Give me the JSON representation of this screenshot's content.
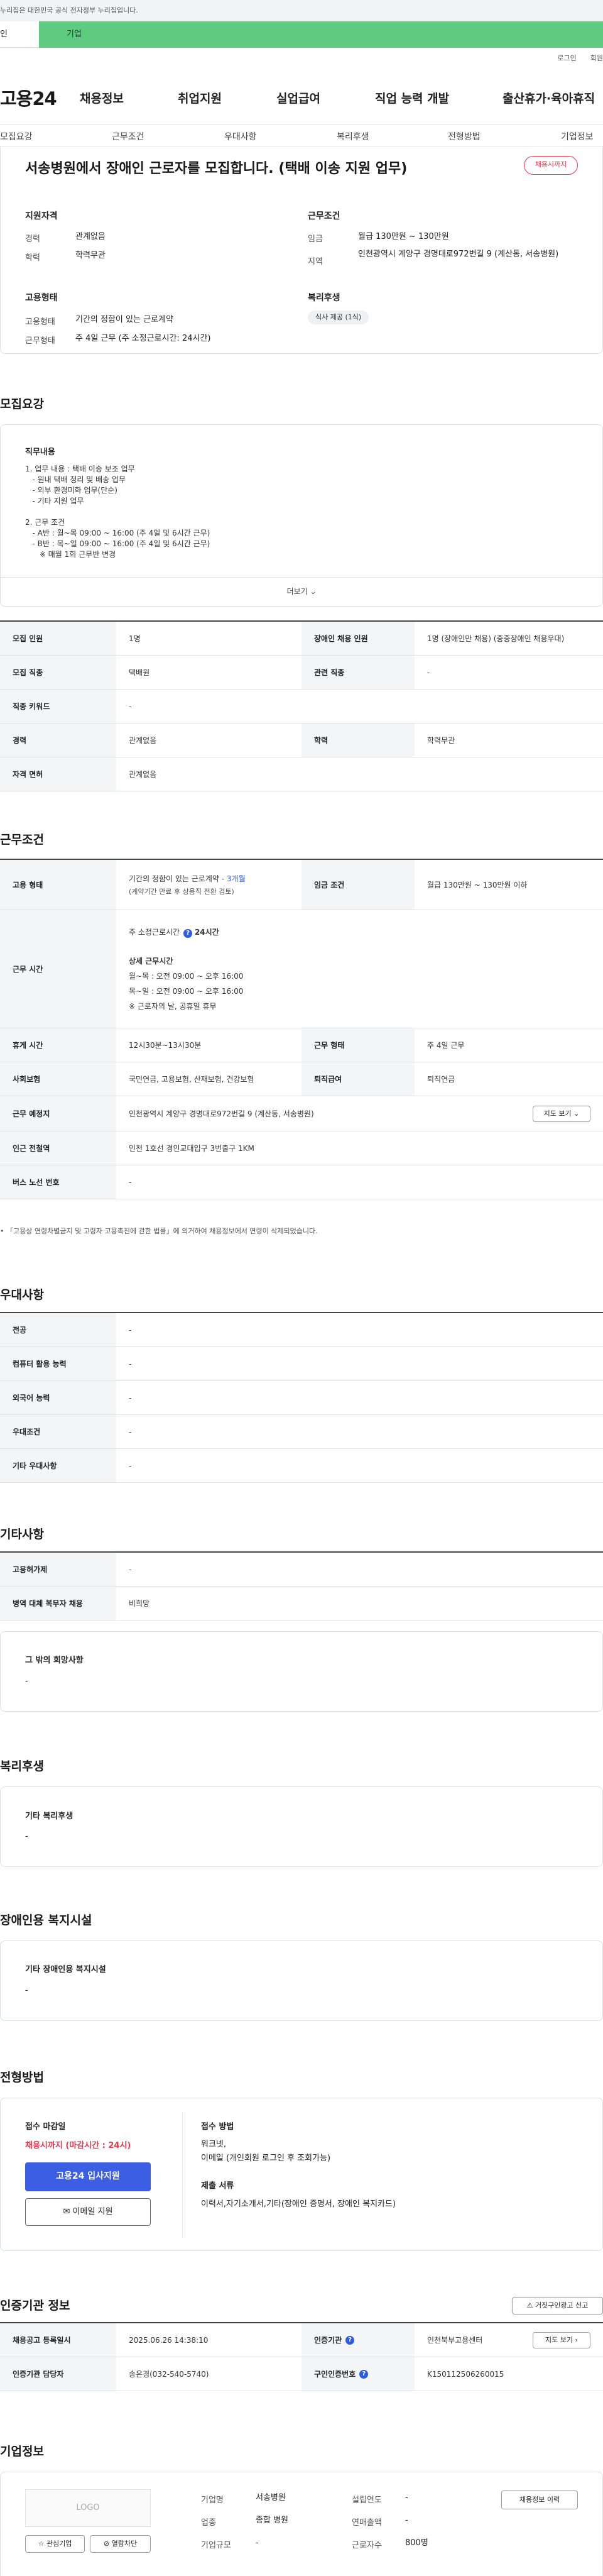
{
  "gov_banner": "누리집은 대한민국 공식 전자정부 누리집입니다.",
  "top_tabs": [
    "인",
    "기업"
  ],
  "util": [
    "로그인",
    "회원"
  ],
  "logo": "고용24",
  "gnb": [
    "채용정보",
    "취업지원",
    "실업급여",
    "직업 능력 개발",
    "출산휴가·육아휴직"
  ],
  "subnav": [
    "모집요강",
    "근무조건",
    "우대사항",
    "복리후생",
    "전형방법",
    "기업정보"
  ],
  "summary": {
    "title": "서송병원에서 장애인 근로자를 모집합니다. (택배 이송 지원 업무)",
    "badge": "채용시까지",
    "qual_heading": "지원자격",
    "career_label": "경력",
    "career_value": "관계없음",
    "edu_label": "학력",
    "edu_value": "학력무관",
    "work_heading": "근무조건",
    "wage_label": "임금",
    "wage_value": "월급 130만원 ~ 130만원",
    "region_label": "지역",
    "region_value": "인천광역시 계양구 경명대로972번길 9 (계산동, 서송병원)",
    "emp_heading": "고용형태",
    "emp_type_label": "고용형태",
    "emp_type_value": "기간의 정함이 있는 근로계약",
    "work_form_label": "근무형태",
    "work_form_value": "주 4일 근무 (주 소정근로시간: 24시간)",
    "welfare_heading": "복리후생",
    "welfare_chip": "식사 제공 (1식)"
  },
  "recruit": {
    "section_title": "모집요강",
    "duty_heading": "직무내용",
    "duty_text": "1. 업무 내용 : 택배 이송 보조 업무\n   - 원내 택배 정리 및 배송 업무\n   - 외부 환경미화 업무(단순)\n   - 기타 지원 업무\n\n2. 근무 조건\n   - A반 : 월~목 09:00 ~ 16:00 (주 4일 및 6시간 근무)\n   - B반 : 목~일 09:00 ~ 16:00 (주 4일 및 6시간 근무)\n      ※ 매월 1회 근무반 변경",
    "more": "더보기",
    "table": [
      {
        "h1": "모집 인원",
        "v1": "1명",
        "h2": "장애인 채용 인원",
        "v2": "1명 (장애인만 채용) (중증장애인 채용우대)"
      },
      {
        "h1": "모집 직종",
        "v1": "택배원",
        "h2": "관련 직종",
        "v2": "-"
      },
      {
        "h1": "직종 키워드",
        "v1": "-"
      },
      {
        "h1": "경력",
        "v1": "관계없음",
        "h2": "학력",
        "v2": "학력무관"
      },
      {
        "h1": "자격 면허",
        "v1": "관계없음"
      }
    ]
  },
  "conditions": {
    "section_title": "근무조건",
    "emp_type_label": "고용 형태",
    "emp_type_value": "기간의 정함이 있는 근로계약 - ",
    "emp_type_months": "3개월",
    "emp_type_note": "(계약기간 만료 후 상용직 전환 검토)",
    "wage_label": "임금 조건",
    "wage_value": "월급 130만원 ~ 130만원 이하",
    "hours_label": "근무 시간",
    "hours_weekly": "주 소정근로시간",
    "hours_weekly_value": "24시간",
    "hours_detail_heading": "상세 근무시간",
    "hours_lines": [
      "월~목 : 오전 09:00 ~ 오후 16:00",
      "목~일 : 오전 09:00 ~ 오후 16:00",
      "※ 근로자의 날, 공휴일 휴무"
    ],
    "rest_label": "휴게 시간",
    "rest_value": "12시30분~13시30분",
    "form_label": "근무 형태",
    "form_value": "주 4일 근무",
    "insurance_label": "사회보험",
    "insurance_value": "국민연금, 고용보험, 산재보험, 건강보험",
    "severance_label": "퇴직급여",
    "severance_value": "퇴직연금",
    "place_label": "근무 예정지",
    "place_value": "인천광역시 계양구 경명대로972번길 9 (계산동, 서송병원)",
    "map_button": "지도 보기",
    "station_label": "인근 전철역",
    "station_value": "인천 1호선 경인교대입구 3번출구 1KM",
    "bus_label": "버스 노선 번호",
    "bus_value": "-",
    "footnote": "「고용상 연령차별금지 및 고령자 고용촉진에 관한 법률」에 의거하여 채용정보에서 연령이 삭제되었습니다."
  },
  "preference": {
    "section_title": "우대사항",
    "rows": [
      {
        "label": "전공",
        "value": "-"
      },
      {
        "label": "컴퓨터 활용 능력",
        "value": "-"
      },
      {
        "label": "외국어 능력",
        "value": "-"
      },
      {
        "label": "우대조건",
        "value": "-"
      },
      {
        "label": "기타 우대사항",
        "value": "-"
      }
    ]
  },
  "etc": {
    "section_title": "기타사항",
    "rows": [
      {
        "label": "고용허가제",
        "value": "-"
      },
      {
        "label": "병역 대체 복무자 채용",
        "value": "비희망"
      }
    ],
    "other_heading": "그 밖의 희망사항",
    "other_value": "-"
  },
  "welfare": {
    "section_title": "복리후생",
    "heading": "기타 복리후생",
    "value": "-"
  },
  "disabled": {
    "section_title": "장애인용 복지시설",
    "heading": "기타 장애인용 복지시설",
    "value": "-"
  },
  "selection": {
    "section_title": "전형방법",
    "deadline_heading": "접수 마감일",
    "deadline_value": "채용시까지 (마감시간 : 24시)",
    "apply_button": "고용24 입사지원",
    "email_button": "이메일 지원",
    "method_heading": "접수 방법",
    "method_lines": [
      "워크넷,",
      "이메일 (개인회원 로그인 후 조회가능)"
    ],
    "docs_heading": "제출 서류",
    "docs_value": "이력서,자기소개서,기타(장애인 증명서, 장애인 복지카드)"
  },
  "cert": {
    "section_title": "인증기관 정보",
    "report_button": "거짓구인광고 신고",
    "reg_label": "채용공고 등록일시",
    "reg_value": "2025.06.26 14:38:10",
    "agency_label": "인증기관",
    "agency_value": "인천북부고용센터",
    "agency_button": "지도 보기",
    "manager_label": "인증기관 담당자",
    "manager_value": "송은경(032-540-5740)",
    "cert_no_label": "구인인증번호",
    "cert_no_value": "K150112506260015"
  },
  "company": {
    "section_title": "기업정보",
    "logo_placeholder": "LOGO",
    "interest_button": "관심기업",
    "block_button": "열람차단",
    "history_button": "채용정보 이력",
    "fields": [
      {
        "label": "기업명",
        "value": "서송병원",
        "label2": "설립연도",
        "value2": "-"
      },
      {
        "label": "업종",
        "value": "종합 병원",
        "label2": "연매출액",
        "value2": "-"
      },
      {
        "label": "기업규모",
        "value": "-",
        "label2": "근로자수",
        "value2": "800명"
      }
    ]
  }
}
